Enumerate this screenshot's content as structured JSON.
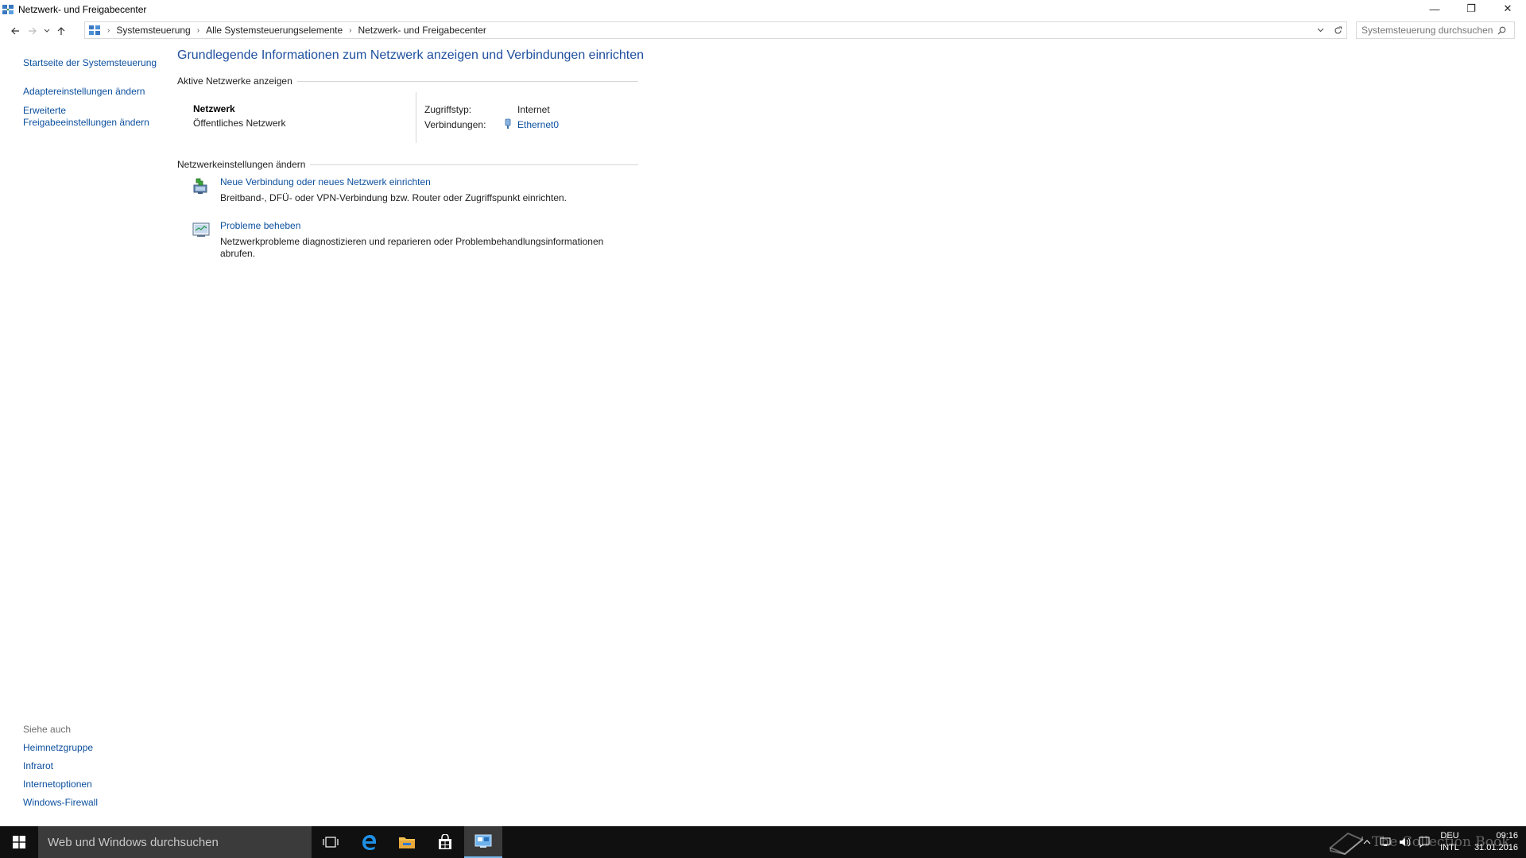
{
  "window": {
    "title": "Netzwerk- und Freigabecenter",
    "controls": {
      "minimize": "—",
      "restore": "❐",
      "close": "✕"
    }
  },
  "navbar": {
    "breadcrumbs": [
      "Systemsteuerung",
      "Alle Systemsteuerungselemente",
      "Netzwerk- und Freigabecenter"
    ],
    "search_placeholder": "Systemsteuerung durchsuchen"
  },
  "sidebar": {
    "links": [
      {
        "label": "Startseite der Systemsteuerung"
      },
      {
        "label": "Adaptereinstellungen ändern"
      },
      {
        "label": "Erweiterte"
      },
      {
        "label": "Freigabeeinstellungen ändern"
      }
    ],
    "see_also_heading": "Siehe auch",
    "see_also": [
      {
        "label": "Heimnetzgruppe"
      },
      {
        "label": "Infrarot"
      },
      {
        "label": "Internetoptionen"
      },
      {
        "label": "Windows-Firewall"
      }
    ]
  },
  "main": {
    "title": "Grundlegende Informationen zum Netzwerk anzeigen und Verbindungen einrichten",
    "active_heading": "Aktive Netzwerke anzeigen",
    "network_name": "Netzwerk",
    "network_category": "Öffentliches Netzwerk",
    "access_label": "Zugriffstyp:",
    "access_value": "Internet",
    "connections_label": "Verbindungen:",
    "connections_value": "Ethernet0",
    "change_heading": "Netzwerkeinstellungen ändern",
    "tasks": [
      {
        "link": "Neue Verbindung oder neues Netzwerk einrichten",
        "desc": "Breitband-, DFÜ- oder VPN-Verbindung bzw. Router oder Zugriffspunkt einrichten."
      },
      {
        "link": "Probleme beheben",
        "desc": "Netzwerkprobleme diagnostizieren und reparieren oder Problembehandlungsinformationen abrufen."
      }
    ]
  },
  "taskbar": {
    "search_placeholder": "Web und Windows durchsuchen",
    "language": "DEU",
    "keyboard": "INTL",
    "time": "09:16",
    "date": "31.01.2016",
    "watermark": "The Collection Book"
  },
  "colors": {
    "link": "#0b4f9e",
    "title_blue": "#1e4e9e",
    "taskbar": "#101010",
    "taskbar_search": "#3b3b3b"
  }
}
